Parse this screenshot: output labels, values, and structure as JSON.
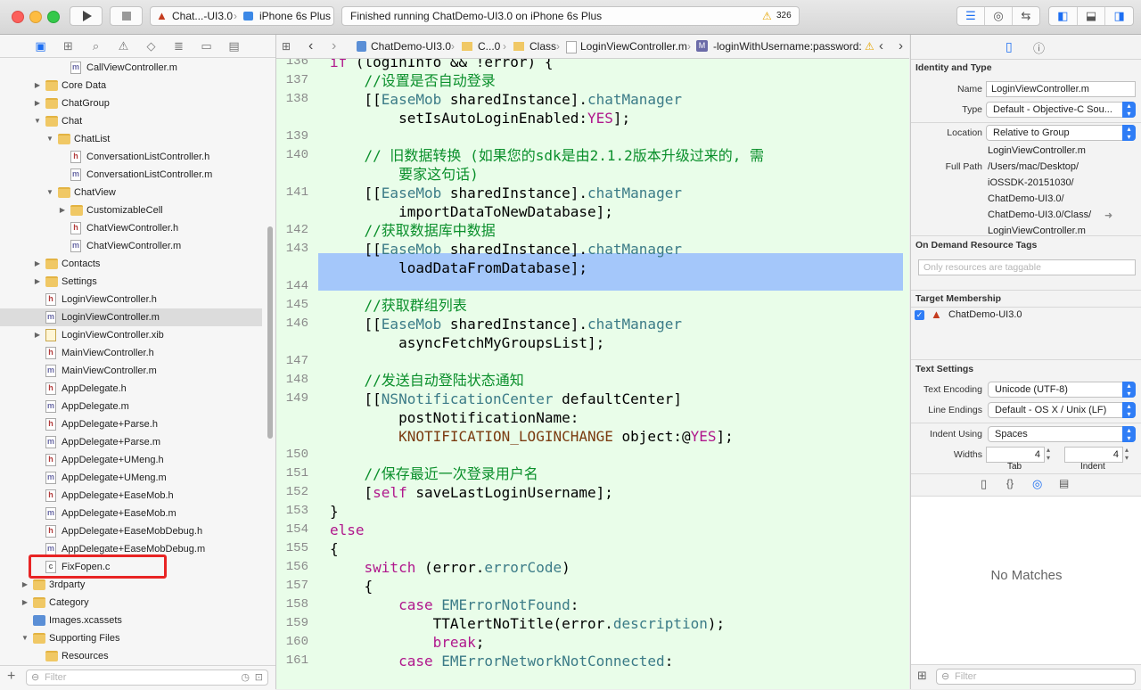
{
  "toolbar": {
    "scheme_target": "Chat...-UI3.0",
    "device": "iPhone 6s Plus",
    "status_text": "Finished running ChatDemo-UI3.0 on iPhone 6s Plus",
    "warning_count": "326"
  },
  "navigator": {
    "filter_placeholder": "Filter",
    "rows": [
      {
        "label": "CallViewController.m",
        "type": "m",
        "indent": 3,
        "disclosure": ""
      },
      {
        "label": "Core Data",
        "type": "folder",
        "indent": 1,
        "disclosure": "▶"
      },
      {
        "label": "ChatGroup",
        "type": "folder",
        "indent": 1,
        "disclosure": "▶"
      },
      {
        "label": "Chat",
        "type": "folder",
        "indent": 1,
        "disclosure": "▼"
      },
      {
        "label": "ChatList",
        "type": "folder",
        "indent": 2,
        "disclosure": "▼"
      },
      {
        "label": "ConversationListController.h",
        "type": "h",
        "indent": 3,
        "disclosure": ""
      },
      {
        "label": "ConversationListController.m",
        "type": "m",
        "indent": 3,
        "disclosure": ""
      },
      {
        "label": "ChatView",
        "type": "folder",
        "indent": 2,
        "disclosure": "▼"
      },
      {
        "label": "CustomizableCell",
        "type": "folder",
        "indent": 3,
        "disclosure": "▶"
      },
      {
        "label": "ChatViewController.h",
        "type": "h",
        "indent": 3,
        "disclosure": ""
      },
      {
        "label": "ChatViewController.m",
        "type": "m",
        "indent": 3,
        "disclosure": ""
      },
      {
        "label": "Contacts",
        "type": "folder",
        "indent": 1,
        "disclosure": "▶"
      },
      {
        "label": "Settings",
        "type": "folder",
        "indent": 1,
        "disclosure": "▶"
      },
      {
        "label": "LoginViewController.h",
        "type": "h",
        "indent": 1,
        "disclosure": ""
      },
      {
        "label": "LoginViewController.m",
        "type": "m",
        "indent": 1,
        "disclosure": "",
        "selected": true
      },
      {
        "label": "LoginViewController.xib",
        "type": "xib",
        "indent": 1,
        "disclosure": "▶"
      },
      {
        "label": "MainViewController.h",
        "type": "h",
        "indent": 1,
        "disclosure": ""
      },
      {
        "label": "MainViewController.m",
        "type": "m",
        "indent": 1,
        "disclosure": ""
      },
      {
        "label": "AppDelegate.h",
        "type": "h",
        "indent": 1,
        "disclosure": ""
      },
      {
        "label": "AppDelegate.m",
        "type": "m",
        "indent": 1,
        "disclosure": ""
      },
      {
        "label": "AppDelegate+Parse.h",
        "type": "h",
        "indent": 1,
        "disclosure": ""
      },
      {
        "label": "AppDelegate+Parse.m",
        "type": "m",
        "indent": 1,
        "disclosure": ""
      },
      {
        "label": "AppDelegate+UMeng.h",
        "type": "h",
        "indent": 1,
        "disclosure": ""
      },
      {
        "label": "AppDelegate+UMeng.m",
        "type": "m",
        "indent": 1,
        "disclosure": ""
      },
      {
        "label": "AppDelegate+EaseMob.h",
        "type": "h",
        "indent": 1,
        "disclosure": ""
      },
      {
        "label": "AppDelegate+EaseMob.m",
        "type": "m",
        "indent": 1,
        "disclosure": ""
      },
      {
        "label": "AppDelegate+EaseMobDebug.h",
        "type": "h",
        "indent": 1,
        "disclosure": ""
      },
      {
        "label": "AppDelegate+EaseMobDebug.m",
        "type": "m",
        "indent": 1,
        "disclosure": ""
      },
      {
        "label": "FixFopen.c",
        "type": "c",
        "indent": 1,
        "disclosure": ""
      },
      {
        "label": "3rdparty",
        "type": "folder",
        "indent": 0,
        "disclosure": "▶"
      },
      {
        "label": "Category",
        "type": "folder",
        "indent": 0,
        "disclosure": "▶"
      },
      {
        "label": "Images.xcassets",
        "type": "asset",
        "indent": 0,
        "disclosure": ""
      },
      {
        "label": "Supporting Files",
        "type": "folder",
        "indent": 0,
        "disclosure": "▼"
      },
      {
        "label": "Resources",
        "type": "folder",
        "indent": 1,
        "disclosure": ""
      }
    ]
  },
  "jumpbar": {
    "crumbs": [
      "ChatDemo-UI3.0",
      "C...0",
      "Class",
      "LoginViewController.m",
      "-loginWithUsername:password:"
    ],
    "method_badge": "M"
  },
  "editor": {
    "lines": [
      {
        "n": "136",
        "html": "        <span class=\"kw\">if</span> (loginInfo &amp;&amp; !error) {"
      },
      {
        "n": "137",
        "html": "            <span class=\"cm\">//设置是否自动登录</span>"
      },
      {
        "n": "138",
        "html": "            [[<span class=\"cls\">EaseMob</span> sharedInstance].<span class=\"mth\">chatManager</span>"
      },
      {
        "n": "",
        "html": "                setIsAutoLoginEnabled:<span class=\"kw\">YES</span>];"
      },
      {
        "n": "139",
        "html": ""
      },
      {
        "n": "140",
        "html": "            <span class=\"cm\">// 旧数据转换 (如果您的sdk是由2.1.2版本升级过来的, 需</span>"
      },
      {
        "n": "",
        "html": "                <span class=\"cm\">要家这句话)</span>"
      },
      {
        "n": "141",
        "html": "            [[<span class=\"cls\">EaseMob</span> sharedInstance].<span class=\"mth\">chatManager</span>"
      },
      {
        "n": "",
        "html": "                importDataToNewDatabase];"
      },
      {
        "n": "142",
        "html": "            <span class=\"cm\">//获取数据库中数据</span>"
      },
      {
        "n": "143",
        "html": "            [[<span class=\"cls\">EaseMob</span> sharedInstance].<span class=\"mth\">chatManager</span>"
      },
      {
        "n": "",
        "html": "                loadDataFromDatabase];"
      },
      {
        "n": "144",
        "html": ""
      },
      {
        "n": "145",
        "html": "            <span class=\"cm\">//获取群组列表</span>"
      },
      {
        "n": "146",
        "html": "            [[<span class=\"cls\">EaseMob</span> sharedInstance].<span class=\"mth\">chatManager</span>"
      },
      {
        "n": "",
        "html": "                asyncFetchMyGroupsList];"
      },
      {
        "n": "147",
        "html": ""
      },
      {
        "n": "148",
        "html": "            <span class=\"cm\">//发送自动登陆状态通知</span>"
      },
      {
        "n": "149",
        "html": "            [[<span class=\"cls\">NSNotificationCenter</span> defaultCenter]"
      },
      {
        "n": "",
        "html": "                postNotificationName:"
      },
      {
        "n": "",
        "html": "                <span class=\"mac\">KNOTIFICATION_LOGINCHANGE</span> object:@<span class=\"kw\">YES</span>];"
      },
      {
        "n": "150",
        "html": ""
      },
      {
        "n": "151",
        "html": "            <span class=\"cm\">//保存最近一次登录用户名</span>"
      },
      {
        "n": "152",
        "html": "            [<span class=\"kw\">self</span> saveLastLoginUsername];"
      },
      {
        "n": "153",
        "html": "        }"
      },
      {
        "n": "154",
        "html": "        <span class=\"kw\">else</span>"
      },
      {
        "n": "155",
        "html": "        {"
      },
      {
        "n": "156",
        "html": "            <span class=\"kw\">switch</span> (error.<span class=\"mth\">errorCode</span>)"
      },
      {
        "n": "157",
        "html": "            {"
      },
      {
        "n": "158",
        "html": "                <span class=\"kw\">case</span> <span class=\"cls\">EMErrorNotFound</span>:"
      },
      {
        "n": "159",
        "html": "                    TTAlertNoTitle(error.<span class=\"mth\">description</span>);"
      },
      {
        "n": "160",
        "html": "                    <span class=\"kw\">break</span>;"
      },
      {
        "n": "161",
        "html": "                <span class=\"kw\">case</span> <span class=\"cls\">EMErrorNetworkNotConnected</span>:"
      }
    ]
  },
  "inspector": {
    "identity_title": "Identity and Type",
    "name_label": "Name",
    "name_value": "LoginViewController.m",
    "type_label": "Type",
    "type_value": "Default - Objective-C Sou...",
    "location_label": "Location",
    "location_value": "Relative to Group",
    "location_file": "LoginViewController.m",
    "fullpath_label": "Full Path",
    "fullpath_lines": [
      "/Users/mac/Desktop/",
      "iOSSDK-20151030/",
      "ChatDemo-UI3.0/",
      "ChatDemo-UI3.0/Class/",
      "LoginViewController.m"
    ],
    "odr_title": "On Demand Resource Tags",
    "odr_placeholder": "Only resources are taggable",
    "target_title": "Target Membership",
    "target_name": "ChatDemo-UI3.0",
    "text_title": "Text Settings",
    "encoding_label": "Text Encoding",
    "encoding_value": "Unicode (UTF-8)",
    "lineend_label": "Line Endings",
    "lineend_value": "Default - OS X / Unix (LF)",
    "indent_label": "Indent Using",
    "indent_value": "Spaces",
    "widths_label": "Widths",
    "tab_width": "4",
    "indent_width": "4",
    "tab_caption": "Tab",
    "indent_caption": "Indent",
    "no_matches": "No Matches",
    "filter_placeholder": "Filter"
  },
  "colors": {
    "accent": "#1c6ef2",
    "editor_bg": "#e9fde9",
    "highlight": "#a4c7fa",
    "red_box": "#e82424"
  }
}
